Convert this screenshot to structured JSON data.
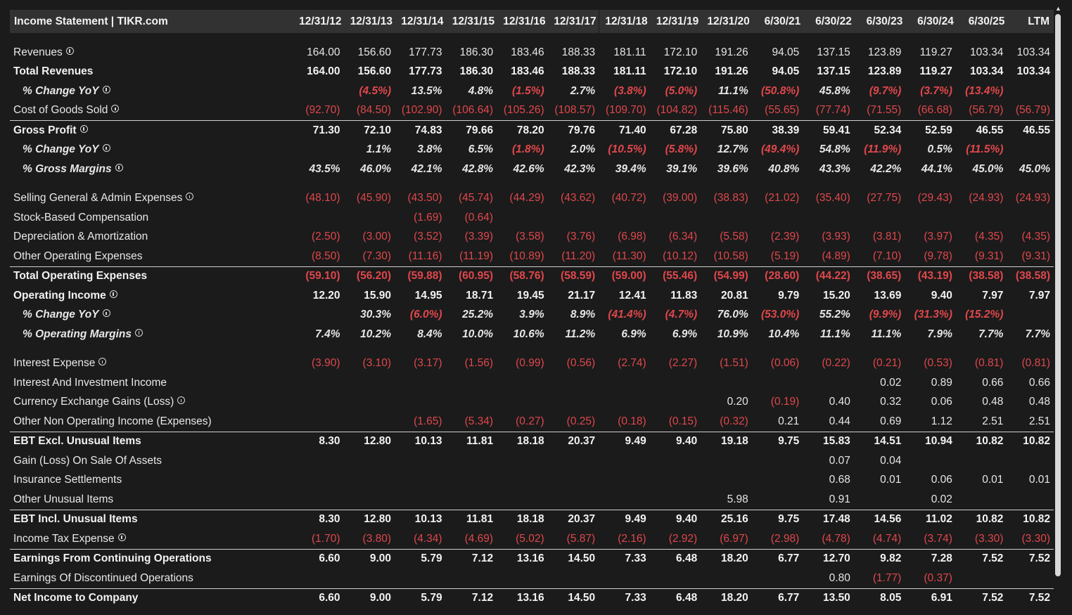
{
  "header": {
    "title": "Income Statement | TIKR.com",
    "periods": [
      "12/31/12",
      "12/31/13",
      "12/31/14",
      "12/31/15",
      "12/31/16",
      "12/31/17",
      "12/31/18",
      "12/31/19",
      "12/31/20",
      "6/30/21",
      "6/30/22",
      "6/30/23",
      "6/30/24",
      "6/30/25",
      "LTM"
    ]
  },
  "rows": [
    {
      "type": "spacer"
    },
    {
      "label": "Revenues",
      "info": true,
      "style": "normal",
      "values": [
        "164.00",
        "156.60",
        "177.73",
        "186.30",
        "183.46",
        "188.33",
        "181.11",
        "172.10",
        "191.26",
        "94.05",
        "137.15",
        "123.89",
        "119.27",
        "103.34",
        "103.34"
      ]
    },
    {
      "label": "Total Revenues",
      "style": "bold",
      "values": [
        "164.00",
        "156.60",
        "177.73",
        "186.30",
        "183.46",
        "188.33",
        "181.11",
        "172.10",
        "191.26",
        "94.05",
        "137.15",
        "123.89",
        "119.27",
        "103.34",
        "103.34"
      ]
    },
    {
      "label": "% Change YoY",
      "info": true,
      "style": "pct",
      "values": [
        "",
        "(4.5%)",
        "13.5%",
        "4.8%",
        "(1.5%)",
        "2.7%",
        "(3.8%)",
        "(5.0%)",
        "11.1%",
        "(50.8%)",
        "45.8%",
        "(9.7%)",
        "(3.7%)",
        "(13.4%)",
        ""
      ]
    },
    {
      "label": "Cost of Goods Sold",
      "info": true,
      "style": "normal",
      "values": [
        "(92.70)",
        "(84.50)",
        "(102.90)",
        "(106.64)",
        "(105.26)",
        "(108.57)",
        "(109.70)",
        "(104.82)",
        "(115.46)",
        "(55.65)",
        "(77.74)",
        "(71.55)",
        "(66.68)",
        "(56.79)",
        "(56.79)"
      ]
    },
    {
      "label": "Gross Profit",
      "info": true,
      "style": "bold",
      "topline": true,
      "values": [
        "71.30",
        "72.10",
        "74.83",
        "79.66",
        "78.20",
        "79.76",
        "71.40",
        "67.28",
        "75.80",
        "38.39",
        "59.41",
        "52.34",
        "52.59",
        "46.55",
        "46.55"
      ]
    },
    {
      "label": "% Change YoY",
      "info": true,
      "style": "pct",
      "values": [
        "",
        "1.1%",
        "3.8%",
        "6.5%",
        "(1.8%)",
        "2.0%",
        "(10.5%)",
        "(5.8%)",
        "12.7%",
        "(49.4%)",
        "54.8%",
        "(11.9%)",
        "0.5%",
        "(11.5%)",
        ""
      ]
    },
    {
      "label": "% Gross Margins",
      "info": true,
      "style": "pct",
      "values": [
        "43.5%",
        "46.0%",
        "42.1%",
        "42.8%",
        "42.6%",
        "42.3%",
        "39.4%",
        "39.1%",
        "39.6%",
        "40.8%",
        "43.3%",
        "42.2%",
        "44.1%",
        "45.0%",
        "45.0%"
      ]
    },
    {
      "type": "spacer"
    },
    {
      "label": "Selling General & Admin Expenses",
      "info": true,
      "style": "normal",
      "values": [
        "(48.10)",
        "(45.90)",
        "(43.50)",
        "(45.74)",
        "(44.29)",
        "(43.62)",
        "(40.72)",
        "(39.00)",
        "(38.83)",
        "(21.02)",
        "(35.40)",
        "(27.75)",
        "(29.43)",
        "(24.93)",
        "(24.93)"
      ]
    },
    {
      "label": "Stock-Based Compensation",
      "style": "normal",
      "values": [
        "",
        "",
        "(1.69)",
        "(0.64)",
        "",
        "",
        "",
        "",
        "",
        "",
        "",
        "",
        "",
        "",
        ""
      ]
    },
    {
      "label": "Depreciation & Amortization",
      "style": "normal",
      "values": [
        "(2.50)",
        "(3.00)",
        "(3.52)",
        "(3.39)",
        "(3.58)",
        "(3.76)",
        "(6.98)",
        "(6.34)",
        "(5.58)",
        "(2.39)",
        "(3.93)",
        "(3.81)",
        "(3.97)",
        "(4.35)",
        "(4.35)"
      ]
    },
    {
      "label": "Other Operating Expenses",
      "style": "normal",
      "values": [
        "(8.50)",
        "(7.30)",
        "(11.16)",
        "(11.19)",
        "(10.89)",
        "(11.20)",
        "(11.30)",
        "(10.12)",
        "(10.58)",
        "(5.19)",
        "(4.89)",
        "(7.10)",
        "(9.78)",
        "(9.31)",
        "(9.31)"
      ]
    },
    {
      "label": "Total Operating Expenses",
      "style": "bold",
      "topline": true,
      "values": [
        "(59.10)",
        "(56.20)",
        "(59.88)",
        "(60.95)",
        "(58.76)",
        "(58.59)",
        "(59.00)",
        "(55.46)",
        "(54.99)",
        "(28.60)",
        "(44.22)",
        "(38.65)",
        "(43.19)",
        "(38.58)",
        "(38.58)"
      ]
    },
    {
      "label": "Operating Income",
      "info": true,
      "style": "bold",
      "values": [
        "12.20",
        "15.90",
        "14.95",
        "18.71",
        "19.45",
        "21.17",
        "12.41",
        "11.83",
        "20.81",
        "9.79",
        "15.20",
        "13.69",
        "9.40",
        "7.97",
        "7.97"
      ]
    },
    {
      "label": "% Change YoY",
      "info": true,
      "style": "pct",
      "values": [
        "",
        "30.3%",
        "(6.0%)",
        "25.2%",
        "3.9%",
        "8.9%",
        "(41.4%)",
        "(4.7%)",
        "76.0%",
        "(53.0%)",
        "55.2%",
        "(9.9%)",
        "(31.3%)",
        "(15.2%)",
        ""
      ]
    },
    {
      "label": "% Operating Margins",
      "info": true,
      "style": "pct",
      "values": [
        "7.4%",
        "10.2%",
        "8.4%",
        "10.0%",
        "10.6%",
        "11.2%",
        "6.9%",
        "6.9%",
        "10.9%",
        "10.4%",
        "11.1%",
        "11.1%",
        "7.9%",
        "7.7%",
        "7.7%"
      ]
    },
    {
      "type": "spacer"
    },
    {
      "label": "Interest Expense",
      "info": true,
      "style": "normal",
      "values": [
        "(3.90)",
        "(3.10)",
        "(3.17)",
        "(1.56)",
        "(0.99)",
        "(0.56)",
        "(2.74)",
        "(2.27)",
        "(1.51)",
        "(0.06)",
        "(0.22)",
        "(0.21)",
        "(0.53)",
        "(0.81)",
        "(0.81)"
      ]
    },
    {
      "label": "Interest And Investment Income",
      "style": "normal",
      "values": [
        "",
        "",
        "",
        "",
        "",
        "",
        "",
        "",
        "",
        "",
        "",
        "0.02",
        "0.89",
        "0.66",
        "0.66"
      ]
    },
    {
      "label": "Currency Exchange Gains (Loss)",
      "info": true,
      "style": "normal",
      "values": [
        "",
        "",
        "",
        "",
        "",
        "",
        "",
        "",
        "0.20",
        "(0.19)",
        "0.40",
        "0.32",
        "0.06",
        "0.48",
        "0.48"
      ]
    },
    {
      "label": "Other Non Operating Income (Expenses)",
      "style": "normal",
      "values": [
        "",
        "",
        "(1.65)",
        "(5.34)",
        "(0.27)",
        "(0.25)",
        "(0.18)",
        "(0.15)",
        "(0.32)",
        "0.21",
        "0.44",
        "0.69",
        "1.12",
        "2.51",
        "2.51"
      ]
    },
    {
      "label": "EBT Excl. Unusual Items",
      "style": "bold",
      "topline": true,
      "values": [
        "8.30",
        "12.80",
        "10.13",
        "11.81",
        "18.18",
        "20.37",
        "9.49",
        "9.40",
        "19.18",
        "9.75",
        "15.83",
        "14.51",
        "10.94",
        "10.82",
        "10.82"
      ]
    },
    {
      "label": "Gain (Loss) On Sale Of Assets",
      "style": "normal",
      "values": [
        "",
        "",
        "",
        "",
        "",
        "",
        "",
        "",
        "",
        "",
        "0.07",
        "0.04",
        "",
        "",
        ""
      ]
    },
    {
      "label": "Insurance Settlements",
      "style": "normal",
      "values": [
        "",
        "",
        "",
        "",
        "",
        "",
        "",
        "",
        "",
        "",
        "0.68",
        "0.01",
        "0.06",
        "0.01",
        "0.01"
      ]
    },
    {
      "label": "Other Unusual Items",
      "style": "normal",
      "values": [
        "",
        "",
        "",
        "",
        "",
        "",
        "",
        "",
        "5.98",
        "",
        "0.91",
        "",
        "0.02",
        "",
        ""
      ]
    },
    {
      "label": "EBT Incl. Unusual Items",
      "style": "bold",
      "topline": true,
      "values": [
        "8.30",
        "12.80",
        "10.13",
        "11.81",
        "18.18",
        "20.37",
        "9.49",
        "9.40",
        "25.16",
        "9.75",
        "17.48",
        "14.56",
        "11.02",
        "10.82",
        "10.82"
      ]
    },
    {
      "label": "Income Tax Expense",
      "info": true,
      "style": "normal",
      "values": [
        "(1.70)",
        "(3.80)",
        "(4.34)",
        "(4.69)",
        "(5.02)",
        "(5.87)",
        "(2.16)",
        "(2.92)",
        "(6.97)",
        "(2.98)",
        "(4.78)",
        "(4.74)",
        "(3.74)",
        "(3.30)",
        "(3.30)"
      ]
    },
    {
      "label": "Earnings From Continuing Operations",
      "style": "bold",
      "topline": true,
      "values": [
        "6.60",
        "9.00",
        "5.79",
        "7.12",
        "13.16",
        "14.50",
        "7.33",
        "6.48",
        "18.20",
        "6.77",
        "12.70",
        "9.82",
        "7.28",
        "7.52",
        "7.52"
      ]
    },
    {
      "label": "Earnings Of Discontinued Operations",
      "style": "normal",
      "values": [
        "",
        "",
        "",
        "",
        "",
        "",
        "",
        "",
        "",
        "",
        "0.80",
        "(1.77)",
        "(0.37)",
        "",
        ""
      ]
    },
    {
      "label": "Net Income to Company",
      "style": "bold",
      "topline": true,
      "values": [
        "6.60",
        "9.00",
        "5.79",
        "7.12",
        "13.16",
        "14.50",
        "7.33",
        "6.48",
        "18.20",
        "6.77",
        "13.50",
        "8.05",
        "6.91",
        "7.52",
        "7.52"
      ]
    }
  ],
  "colors": {
    "negative": "#e0474c",
    "background": "#1b1b1b",
    "header_bg": "#323232",
    "text": "#e6e6e6"
  }
}
